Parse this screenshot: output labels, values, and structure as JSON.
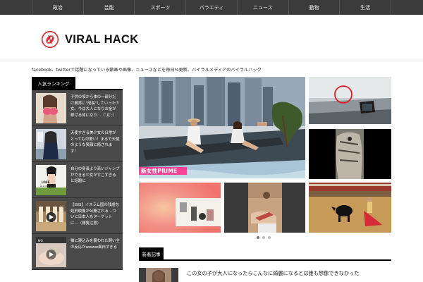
{
  "nav": {
    "items": [
      "政治",
      "芸能",
      "スポーツ",
      "バラエティ",
      "ニュース",
      "動物",
      "生活"
    ]
  },
  "header": {
    "logo_text": "VIRAL HACK"
  },
  "tagline": "facebook、twitterで話題になっている動画や画像、ニュースなどを毎日%更新。バイラルメディアのバイラルハック",
  "sidebar": {
    "title": "人気ランキング",
    "items": [
      {
        "text": "子供の頃から体の一部分だけ異常に\"成長\"していった少女。今は大人になりお金が稼げる体になり…（ﾟДﾟ;）"
      },
      {
        "text": "天使すぎる美少女の日常がとっても可愛い！まるで天使のような笑顔に癒されます！"
      },
      {
        "text": "自分の身長より高いジャンプができる少女がすごすぎると話題に"
      },
      {
        "text": "【ISIS】イスラム国の残虐な処刑映像が公開される…ついに日本人もターゲットに…（閲覧注意）"
      },
      {
        "text": "猫に寝込みを襲われた飼い主の反応がwwww面白すぎる"
      }
    ]
  },
  "carousel": {
    "main_overlay": "新女性PRIME",
    "dots": 3,
    "active_dot": 0
  },
  "news": {
    "title": "新着記事",
    "first_text": "この女の子が大人になったらこんなに綺麗になるとは誰も想像できなかった"
  },
  "colors": {
    "nav_bg": "#3b3b3b",
    "sidebar_bg": "#4a4a4a",
    "logo_red": "#d8282f",
    "overlay_pink": "#ff2a8a"
  }
}
